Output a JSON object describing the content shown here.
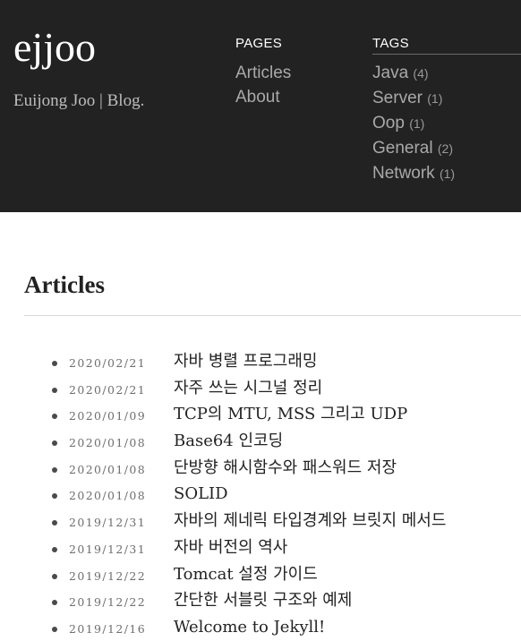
{
  "site": {
    "logo": "ejjoo",
    "tagline": "Euijong Joo | Blog."
  },
  "nav": {
    "pages_title": "PAGES",
    "pages": [
      "Articles",
      "About"
    ],
    "tags_title": "TAGS",
    "tags": [
      {
        "name": "Java",
        "count": "(4)"
      },
      {
        "name": "Server",
        "count": "(1)"
      },
      {
        "name": "Oop",
        "count": "(1)"
      },
      {
        "name": "General",
        "count": "(2)"
      },
      {
        "name": "Network",
        "count": "(1)"
      }
    ]
  },
  "main": {
    "title": "Articles",
    "posts": [
      {
        "date": "2020/02/21",
        "title": "자바 병렬 프로그래밍"
      },
      {
        "date": "2020/02/21",
        "title": "자주 쓰는 시그널 정리"
      },
      {
        "date": "2020/01/09",
        "title": "TCP의 MTU, MSS 그리고 UDP"
      },
      {
        "date": "2020/01/08",
        "title": "Base64 인코딩"
      },
      {
        "date": "2020/01/08",
        "title": "단방향 해시함수와 패스워드 저장"
      },
      {
        "date": "2020/01/08",
        "title": "SOLID"
      },
      {
        "date": "2019/12/31",
        "title": "자바의 제네릭 타입경계와 브릿지 메서드"
      },
      {
        "date": "2019/12/31",
        "title": "자바 버전의 역사"
      },
      {
        "date": "2019/12/22",
        "title": "Tomcat 설정 가이드"
      },
      {
        "date": "2019/12/22",
        "title": "간단한 서블릿 구조와 예제"
      },
      {
        "date": "2019/12/16",
        "title": "Welcome to Jekyll!"
      }
    ]
  }
}
